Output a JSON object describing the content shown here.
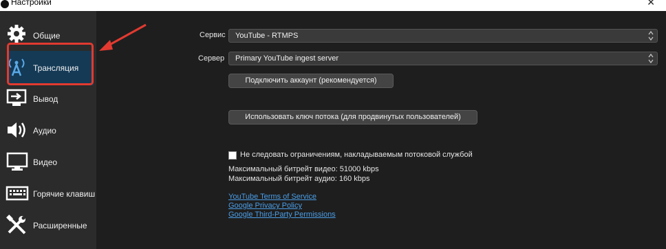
{
  "window": {
    "title": "Настройки",
    "close_glyph": "✕"
  },
  "sidebar": {
    "items": [
      {
        "label": "Общие",
        "icon": "gear-icon"
      },
      {
        "label": "Трансляция",
        "icon": "broadcast-antenna-icon",
        "active": true
      },
      {
        "label": "Вывод",
        "icon": "output-icon"
      },
      {
        "label": "Аудио",
        "icon": "speaker-icon"
      },
      {
        "label": "Видео",
        "icon": "monitor-icon"
      },
      {
        "label": "Горячие клавиш",
        "icon": "keyboard-icon"
      },
      {
        "label": "Расширенные",
        "icon": "tools-icon"
      }
    ]
  },
  "stream": {
    "service_label": "Сервис",
    "service_value": "YouTube - RTMPS",
    "server_label": "Сервер",
    "server_value": "Primary YouTube ingest server",
    "connect_account_button": "Подключить аккаунт (рекомендуется)",
    "use_stream_key_button": "Использовать ключ потока (для продвинутых пользователей)",
    "ignore_limits_checkbox": "Не следовать ограничениям, накладываемым потоковой службой",
    "max_video_bitrate": "Максимальный битрейт видео: 51000 kbps",
    "max_audio_bitrate": "Максимальный битрейт аудио: 160 kbps",
    "links": [
      "YouTube Terms of Service",
      "Google Privacy Policy",
      "Google Third-Party Permissions"
    ]
  },
  "colors": {
    "highlight": "#e23a30",
    "link": "#4a9ee8",
    "active_bg": "#143a56"
  }
}
